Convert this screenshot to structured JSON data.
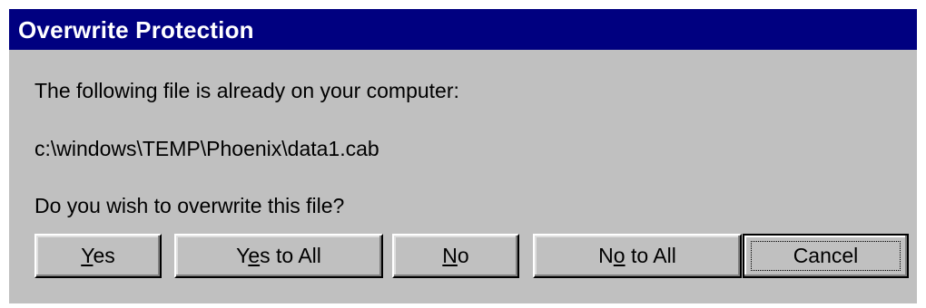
{
  "window": {
    "title": "Overwrite Protection"
  },
  "message": {
    "line1": "The following file is already on your computer:",
    "file_path": "c:\\windows\\TEMP\\Phoenix\\data1.cab",
    "question": "Do you wish to overwrite this file?"
  },
  "buttons": {
    "yes": {
      "pre": "",
      "key": "Y",
      "post": "es"
    },
    "yes_to_all": {
      "pre": "Y",
      "key": "e",
      "post": "s to All"
    },
    "no": {
      "pre": "",
      "key": "N",
      "post": "o"
    },
    "no_to_all": {
      "pre": "N",
      "key": "o",
      "post": " to All"
    },
    "cancel": {
      "label": "Cancel"
    }
  },
  "colors": {
    "titlebar": "#000080",
    "dialog_face": "#c0c0c0",
    "title_text": "#ffffff"
  }
}
